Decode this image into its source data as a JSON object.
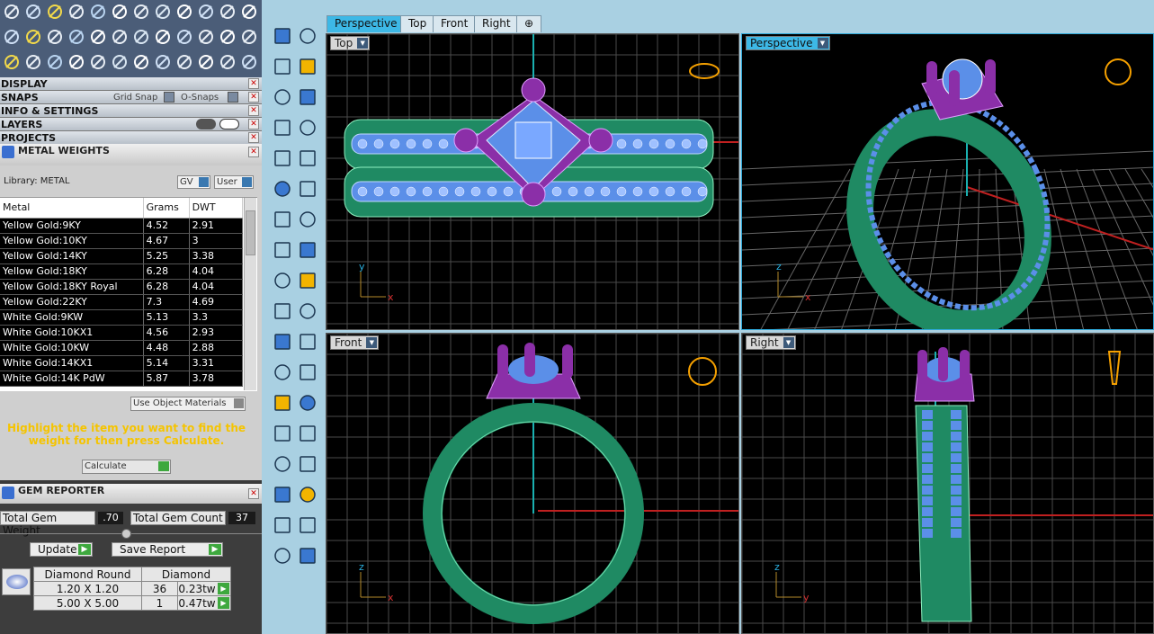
{
  "panels": {
    "display": "DISPLAY",
    "snaps": "SNAPS",
    "grid_snap": "Grid Snap",
    "o_snaps": "O-Snaps",
    "info_settings": "INFO & SETTINGS",
    "layers": "LAYERS",
    "projects": "PROJECTS"
  },
  "metal_weights": {
    "title": "METAL WEIGHTS",
    "library": "Library: METAL",
    "gv_label": "GV",
    "user_label": "User",
    "columns": [
      "Metal",
      "Grams",
      "DWT"
    ],
    "rows": [
      [
        "Yellow Gold:9KY",
        "4.52",
        "2.91"
      ],
      [
        "Yellow Gold:10KY",
        "4.67",
        "3"
      ],
      [
        "Yellow Gold:14KY",
        "5.25",
        "3.38"
      ],
      [
        "Yellow Gold:18KY",
        "6.28",
        "4.04"
      ],
      [
        "Yellow Gold:18KY Royal",
        "6.28",
        "4.04"
      ],
      [
        "Yellow Gold:22KY",
        "7.3",
        "4.69"
      ],
      [
        "White Gold:9KW",
        "5.13",
        "3.3"
      ],
      [
        "White Gold:10KX1",
        "4.56",
        "2.93"
      ],
      [
        "White Gold:10KW",
        "4.48",
        "2.88"
      ],
      [
        "White Gold:14KX1",
        "5.14",
        "3.31"
      ],
      [
        "White Gold:14K PdW",
        "5.87",
        "3.78"
      ]
    ],
    "use_object_materials": "Use Object Materials",
    "hint": "Highlight the item you want to find the weight for then press Calculate.",
    "calculate": "Calculate"
  },
  "gem_reporter": {
    "title": "GEM REPORTER",
    "total_weight_label": "Total Gem Weight",
    "total_weight_value": ".70",
    "total_count_label": "Total Gem Count",
    "total_count_value": "37",
    "update": "Update",
    "save_report": "Save Report",
    "table_header": [
      "Diamond Round",
      "Diamond"
    ],
    "table_rows": [
      [
        "1.20 X 1.20",
        "36",
        "0.23tw"
      ],
      [
        "5.00 X 5.00",
        "1",
        "0.47tw"
      ]
    ]
  },
  "tabs": [
    "Perspective",
    "Top",
    "Front",
    "Right",
    "⊕"
  ],
  "viewports": {
    "top": "Top",
    "perspective": "Perspective",
    "front": "Front",
    "right": "Right"
  },
  "axes": {
    "x": "x",
    "y": "y",
    "z": "z"
  },
  "colors": {
    "metal": "#1f8a63",
    "prong": "#8b2fa8",
    "stone": "#5b8fe8",
    "accent": "#3db8e6",
    "hint": "#f5c400"
  }
}
